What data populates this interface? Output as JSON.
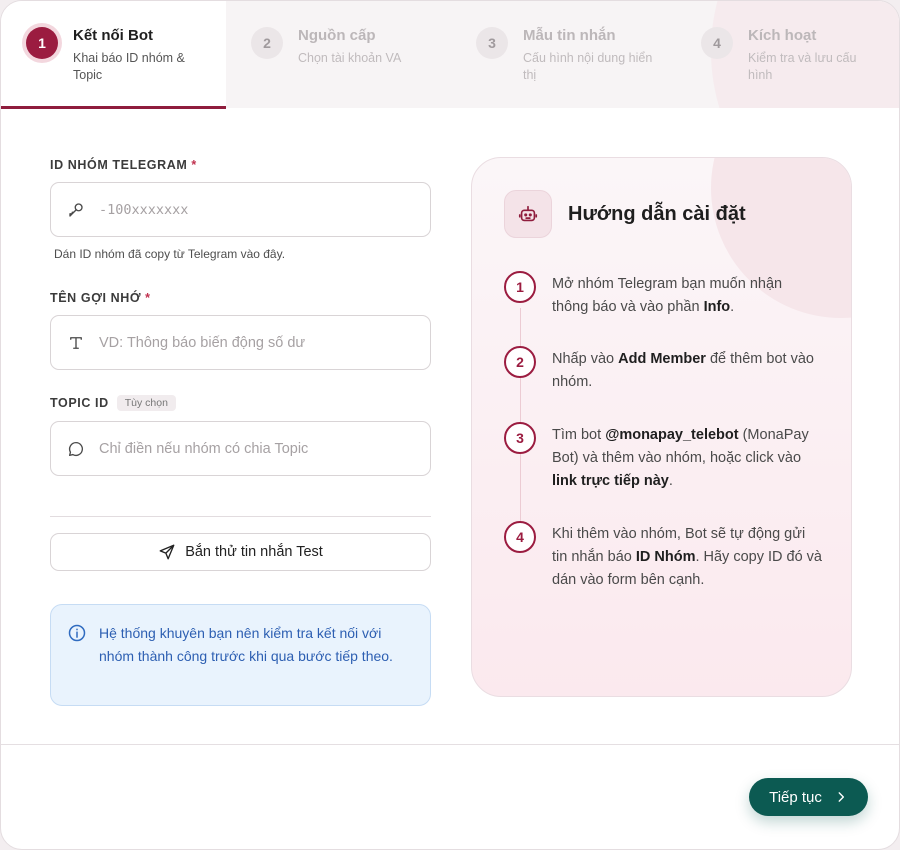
{
  "steps": [
    {
      "num": "1",
      "title": "Kết nối Bot",
      "desc": "Khai báo ID nhóm & Topic"
    },
    {
      "num": "2",
      "title": "Nguồn cấp",
      "desc": "Chọn tài khoản VA"
    },
    {
      "num": "3",
      "title": "Mẫu tin nhắn",
      "desc": "Cấu hình nội dung hiển thị"
    },
    {
      "num": "4",
      "title": "Kích hoạt",
      "desc": "Kiểm tra và lưu cấu hình"
    }
  ],
  "form": {
    "group_id": {
      "label": "ID NHÓM TELEGRAM",
      "required": "*",
      "placeholder": "-100xxxxxxx",
      "value": "",
      "hint": "Dán ID nhóm đã copy từ Telegram vào đây.",
      "icon": "key-icon"
    },
    "alias": {
      "label": "TÊN GỢI NHỚ",
      "required": "*",
      "placeholder": "VD: Thông báo biến động số dư",
      "value": "",
      "icon": "text-icon"
    },
    "topic": {
      "label": "TOPIC ID",
      "optional_badge": "Tùy chọn",
      "placeholder": "Chỉ điền nếu nhóm có chia Topic",
      "value": "",
      "icon": "chat-bubble-icon"
    },
    "test_button": "Bắn thử tin nhắn Test",
    "info": "Hệ thống khuyên bạn nên kiểm tra kết nối với nhóm thành công trước khi qua bước tiếp theo."
  },
  "guide": {
    "title": "Hướng dẫn cài đặt",
    "icon": "robot-icon",
    "steps": [
      {
        "num": "1",
        "parts": [
          "Mở nhóm Telegram bạn muốn nhận thông báo và vào phần ",
          "Info",
          "."
        ]
      },
      {
        "num": "2",
        "parts": [
          "Nhấp vào ",
          "Add Member",
          " để thêm bot vào nhóm."
        ]
      },
      {
        "num": "3",
        "parts": [
          "Tìm bot ",
          "@monapay_telebot",
          " (MonaPay Bot) và thêm vào nhóm, hoặc click vào ",
          "link trực tiếp này",
          "."
        ]
      },
      {
        "num": "4",
        "parts": [
          "Khi thêm vào nhóm, Bot sẽ tự động gửi tin nhắn báo ",
          "ID Nhóm",
          ". Hãy copy ID đó và dán vào form bên cạnh."
        ]
      }
    ]
  },
  "footer": {
    "next_button": "Tiếp tục"
  },
  "colors": {
    "brand": "#9b1c40",
    "primary_button": "#0c5a52",
    "info": "#2d5fb2"
  }
}
